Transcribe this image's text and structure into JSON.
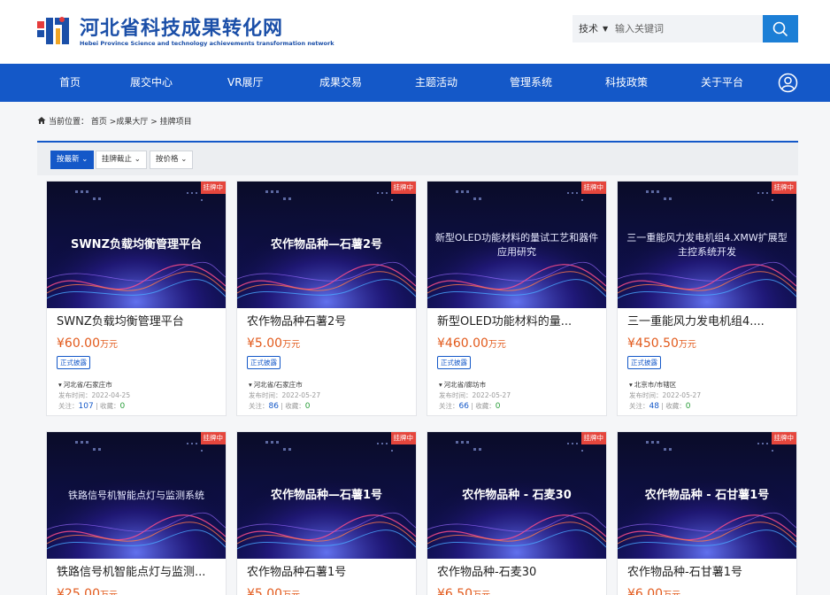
{
  "header": {
    "logo_title": "河北省科技成果转化网",
    "logo_subtitle": "Hebei Province Science and technology achievements transformation network"
  },
  "search": {
    "category": "技术",
    "placeholder": "输入关键词"
  },
  "nav": {
    "items": [
      "首页",
      "展交中心",
      "VR展厅",
      "成果交易",
      "主题活动",
      "管理系统",
      "科技政策",
      "关于平台"
    ]
  },
  "breadcrumb": {
    "prefix": "当前位置：",
    "home": "首页",
    "hall": "成果大厅",
    "current": "挂牌项目",
    "sep": ">"
  },
  "sort": {
    "latest": "按最新",
    "deadline": "挂牌截止",
    "price": "按价格"
  },
  "labels": {
    "badge": "挂牌中",
    "currency": "¥",
    "unit": "万元",
    "tag": "正式披露",
    "date_prefix": "发布时间：",
    "follow": "关注：",
    "favorite": "收藏："
  },
  "cards": [
    {
      "thumb_text": "SWNZ负载均衡管理平台",
      "title": "SWNZ负载均衡管理平台",
      "price": "60.00",
      "location": "河北省/石家庄市",
      "date": "2022-04-25",
      "follows": "107",
      "favorites": "0"
    },
    {
      "thumb_text": "农作物品种—石薯2号",
      "title": "农作物品种石薯2号",
      "price": "5.00",
      "location": "河北省/石家庄市",
      "date": "2022-05-27",
      "follows": "86",
      "favorites": "0"
    },
    {
      "thumb_text": "新型OLED功能材料的量试工艺和器件应用研究",
      "title": "新型OLED功能材料的量...",
      "price": "460.00",
      "location": "河北省/廊坊市",
      "date": "2022-05-27",
      "follows": "66",
      "favorites": "0"
    },
    {
      "thumb_text": "三一重能风力发电机组4.XMW扩展型主控系统开发",
      "title": "三一重能风力发电机组4....",
      "price": "450.50",
      "location": "北京市/市辖区",
      "date": "2022-05-27",
      "follows": "48",
      "favorites": "0"
    },
    {
      "thumb_text": "铁路信号机智能点灯与监测系统",
      "title": "铁路信号机智能点灯与监测...",
      "price": "25.00"
    },
    {
      "thumb_text": "农作物品种—石薯1号",
      "title": "农作物品种石薯1号",
      "price": "5.00"
    },
    {
      "thumb_text": "农作物品种 - 石麦30",
      "title": "农作物品种-石麦30",
      "price": "6.50"
    },
    {
      "thumb_text": "农作物品种 - 石甘薯1号",
      "title": "农作物品种-石甘薯1号",
      "price": "6.00"
    }
  ]
}
